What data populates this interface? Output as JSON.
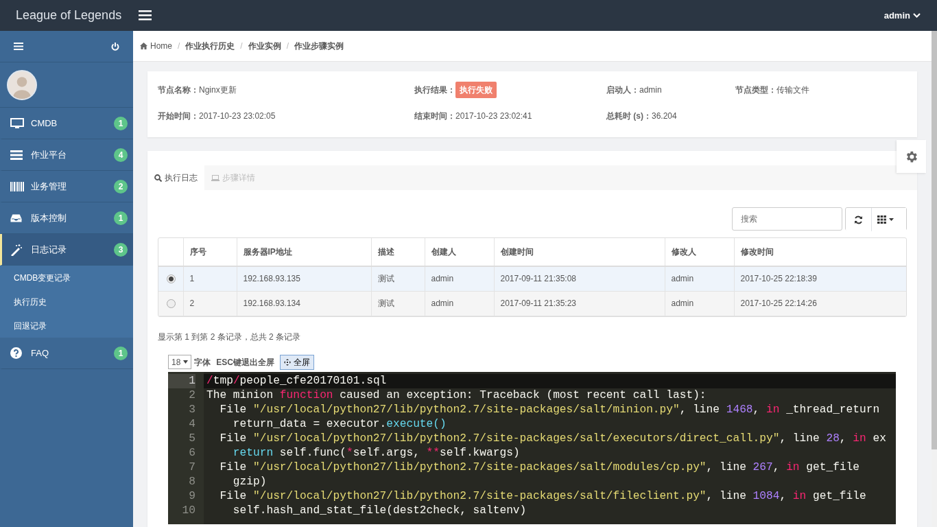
{
  "topbar": {
    "brand": "League of Legends",
    "user": "admin"
  },
  "sidebar": {
    "items": [
      {
        "label": "CMDB",
        "badge": "1",
        "selected": false
      },
      {
        "label": "作业平台",
        "badge": "4",
        "selected": false
      },
      {
        "label": "业务管理",
        "badge": "2",
        "selected": false
      },
      {
        "label": "版本控制",
        "badge": "1",
        "selected": false
      },
      {
        "label": "日志记录",
        "badge": "3",
        "selected": true,
        "children": [
          {
            "label": "CMDB变更记录"
          },
          {
            "label": "执行历史"
          },
          {
            "label": "回退记录"
          }
        ]
      },
      {
        "label": "FAQ",
        "badge": "1",
        "selected": false
      }
    ]
  },
  "breadcrumb": {
    "separator": "/",
    "items": [
      "Home",
      "作业执行历史",
      "作业实例",
      "作业步骤实例"
    ]
  },
  "info": [
    {
      "label": "节点名称：",
      "value": "Nginx更新",
      "kind": "text"
    },
    {
      "label": "执行结果：",
      "value": "执行失败",
      "kind": "badge"
    },
    {
      "label": "启动人：",
      "value": "admin",
      "kind": "text"
    },
    {
      "label": "节点类型：",
      "value": "传输文件",
      "kind": "text"
    },
    {
      "label": "开始时间：",
      "value": "2017-10-23 23:02:05",
      "kind": "text"
    },
    {
      "label": "结束时间：",
      "value": "2017-10-23 23:02:41",
      "kind": "text"
    },
    {
      "label": "总耗时 (s)：",
      "value": "36.204",
      "kind": "text"
    }
  ],
  "tabs": [
    {
      "label": "执行日志",
      "selected": true
    },
    {
      "label": "步骤详情",
      "selected": false
    }
  ],
  "search": {
    "placeholder": "搜索"
  },
  "table": {
    "columns": [
      "序号",
      "服务器IP地址",
      "描述",
      "创建人",
      "创建时间",
      "修改人",
      "修改时间"
    ],
    "rows": [
      {
        "selected": true,
        "cells": [
          "1",
          "192.168.93.135",
          "测试",
          "admin",
          "2017-09-11 21:35:08",
          "admin",
          "2017-10-25 22:18:39"
        ]
      },
      {
        "selected": false,
        "cells": [
          "2",
          "192.168.93.134",
          "测试",
          "admin",
          "2017-09-11 21:35:23",
          "admin",
          "2017-10-25 22:14:26"
        ]
      }
    ]
  },
  "pagination_info": "显示第 1 到第 2 条记录，总共 2 条记录",
  "editor": {
    "font_size": "18",
    "font_label": "字体",
    "esc_hint": "ESC键退出全屏",
    "fullscreen_button": "全屏",
    "lines": [
      {
        "number": "1",
        "active": true,
        "tokens": [
          {
            "kind": "keyword",
            "text": "/"
          },
          {
            "kind": "plain",
            "text": "tmp"
          },
          {
            "kind": "keyword",
            "text": "/"
          },
          {
            "kind": "plain",
            "text": "people_cfe20170101.sql"
          }
        ]
      },
      {
        "number": "2",
        "active": false,
        "tokens": [
          {
            "kind": "plain",
            "text": "The minion "
          },
          {
            "kind": "keyword",
            "text": "function"
          },
          {
            "kind": "plain",
            "text": " caused an exception: Traceback (most recent call last):"
          }
        ]
      },
      {
        "number": "3",
        "active": false,
        "tokens": [
          {
            "kind": "plain",
            "text": "  File "
          },
          {
            "kind": "string",
            "text": "\"/usr/local/python27/lib/python2.7/site-packages/salt/minion.py\""
          },
          {
            "kind": "plain",
            "text": ", line "
          },
          {
            "kind": "number",
            "text": "1468"
          },
          {
            "kind": "plain",
            "text": ", "
          },
          {
            "kind": "keyword",
            "text": "in"
          },
          {
            "kind": "plain",
            "text": " _thread_return"
          }
        ]
      },
      {
        "number": "4",
        "active": false,
        "tokens": [
          {
            "kind": "plain",
            "text": "    return_data = executor."
          },
          {
            "kind": "call",
            "text": "execute()"
          }
        ]
      },
      {
        "number": "5",
        "active": false,
        "tokens": [
          {
            "kind": "plain",
            "text": "  File "
          },
          {
            "kind": "string",
            "text": "\"/usr/local/python27/lib/python2.7/site-packages/salt/executors/direct_call.py\""
          },
          {
            "kind": "plain",
            "text": ", line "
          },
          {
            "kind": "number",
            "text": "28"
          },
          {
            "kind": "plain",
            "text": ", "
          },
          {
            "kind": "keyword",
            "text": "in"
          },
          {
            "kind": "plain",
            "text": " ex"
          }
        ]
      },
      {
        "number": "6",
        "active": false,
        "tokens": [
          {
            "kind": "call",
            "text": "    return"
          },
          {
            "kind": "plain",
            "text": " self.func("
          },
          {
            "kind": "keyword",
            "text": "*"
          },
          {
            "kind": "plain",
            "text": "self.args, "
          },
          {
            "kind": "keyword",
            "text": "**"
          },
          {
            "kind": "plain",
            "text": "self.kwargs)"
          }
        ]
      },
      {
        "number": "7",
        "active": false,
        "tokens": [
          {
            "kind": "plain",
            "text": "  File "
          },
          {
            "kind": "string",
            "text": "\"/usr/local/python27/lib/python2.7/site-packages/salt/modules/cp.py\""
          },
          {
            "kind": "plain",
            "text": ", line "
          },
          {
            "kind": "number",
            "text": "267"
          },
          {
            "kind": "plain",
            "text": ", "
          },
          {
            "kind": "keyword",
            "text": "in"
          },
          {
            "kind": "plain",
            "text": " get_file"
          }
        ]
      },
      {
        "number": "8",
        "active": false,
        "tokens": [
          {
            "kind": "plain",
            "text": "    gzip)"
          }
        ]
      },
      {
        "number": "9",
        "active": false,
        "tokens": [
          {
            "kind": "plain",
            "text": "  File "
          },
          {
            "kind": "string",
            "text": "\"/usr/local/python27/lib/python2.7/site-packages/salt/fileclient.py\""
          },
          {
            "kind": "plain",
            "text": ", line "
          },
          {
            "kind": "number",
            "text": "1084"
          },
          {
            "kind": "plain",
            "text": ", "
          },
          {
            "kind": "keyword",
            "text": "in"
          },
          {
            "kind": "plain",
            "text": " get_file"
          }
        ]
      },
      {
        "number": "10",
        "active": false,
        "tokens": [
          {
            "kind": "plain",
            "text": "    self.hash_and_stat_file(dest2check, saltenv)"
          }
        ]
      }
    ]
  }
}
